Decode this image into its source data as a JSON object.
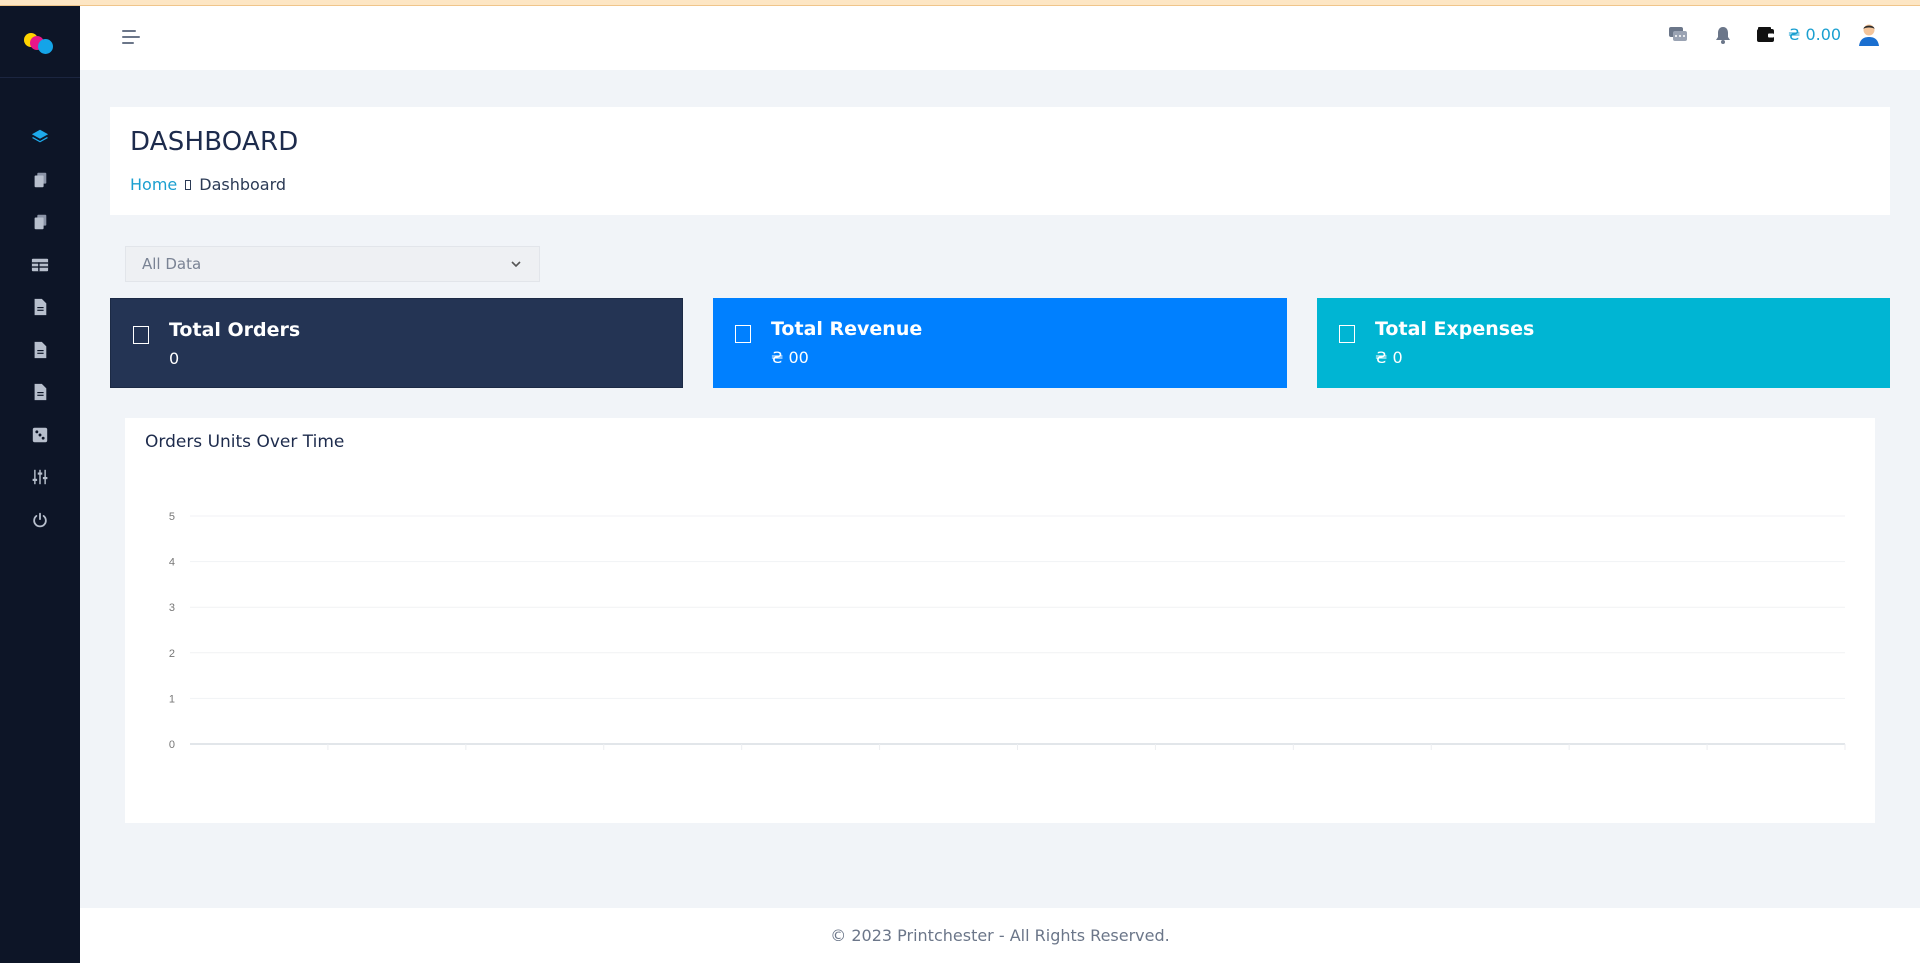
{
  "sidebar": {
    "logo": "printchester-logo",
    "items": [
      {
        "icon": "layers-icon",
        "name": "sidebar-item-dashboard",
        "active": true
      },
      {
        "icon": "files-icon",
        "name": "sidebar-item-files-1"
      },
      {
        "icon": "files-icon",
        "name": "sidebar-item-files-2"
      },
      {
        "icon": "table-icon",
        "name": "sidebar-item-table"
      },
      {
        "icon": "document-icon",
        "name": "sidebar-item-document-1"
      },
      {
        "icon": "document-icon",
        "name": "sidebar-item-document-2"
      },
      {
        "icon": "document-icon",
        "name": "sidebar-item-document-3"
      },
      {
        "icon": "dice-icon",
        "name": "sidebar-item-dice"
      },
      {
        "icon": "sliders-icon",
        "name": "sidebar-item-settings"
      },
      {
        "icon": "power-icon",
        "name": "sidebar-item-logout"
      }
    ]
  },
  "header": {
    "wallet_amount": "₴ 0.00",
    "icons": [
      "chat-icon",
      "bell-icon",
      "wallet-icon",
      "user-avatar-icon"
    ]
  },
  "page": {
    "title": "DASHBOARD",
    "breadcrumb": {
      "home": "Home",
      "current": "Dashboard"
    }
  },
  "filter": {
    "selected": "All Data"
  },
  "stats": [
    {
      "label": "Total Orders",
      "value": "0"
    },
    {
      "label": "Total Revenue",
      "value": "₴ 00"
    },
    {
      "label": "Total Expenses",
      "value": "₴ 0"
    }
  ],
  "chart_data": {
    "type": "line",
    "title": "Orders Units Over Time",
    "y_ticks": [
      "0",
      "1",
      "2",
      "3",
      "4",
      "5"
    ],
    "ylim": [
      0,
      5
    ],
    "x": [],
    "series": [],
    "grid": true
  },
  "footer": {
    "text": "© 2023 Printchester - All Rights Reserved."
  },
  "colors": {
    "sidebar": "#0d1527",
    "accent": "#1a9fd0",
    "orders_card": "#243454",
    "revenue_card": "#0080ff",
    "expenses_card": "#00b5d3"
  }
}
